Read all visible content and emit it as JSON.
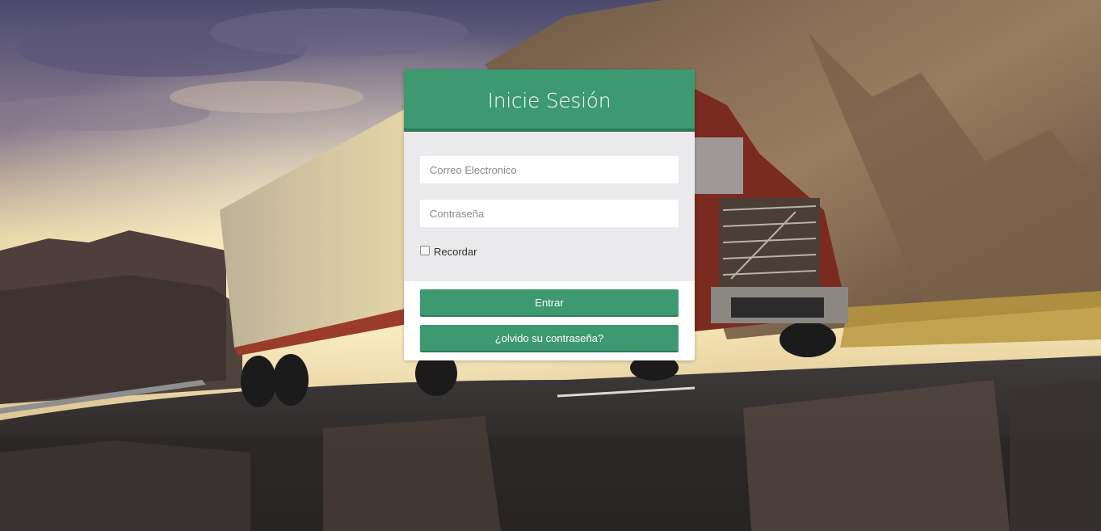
{
  "login": {
    "title": "Inicie Sesión",
    "email_placeholder": "Correo Electronico",
    "password_placeholder": "Contraseña",
    "remember_label": "Recordar",
    "remember_checked": false,
    "submit_label": "Entrar",
    "forgot_label": "¿olvido su contraseña?"
  },
  "background": {
    "description_icon": "truck-landscape-photo"
  },
  "colors": {
    "accent": "#3d9970",
    "accent_dark": "#2f7a59",
    "form_bg": "#eaeaec"
  }
}
